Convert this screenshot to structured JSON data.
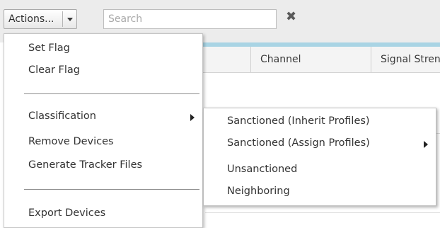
{
  "toolbar": {
    "actions_label": "Actions...",
    "search_placeholder": "Search",
    "clear_glyph": "✖"
  },
  "table": {
    "columns": [
      "Channel",
      "Signal Strength"
    ]
  },
  "actions_menu": {
    "items": [
      {
        "label": "Set Flag"
      },
      {
        "label": "Clear Flag"
      },
      {
        "label": "Classification",
        "has_submenu": true
      },
      {
        "label": "Remove Devices"
      },
      {
        "label": "Generate Tracker Files"
      },
      {
        "label": "Export Devices"
      }
    ]
  },
  "classification_submenu": {
    "items": [
      {
        "label": "Sanctioned (Inherit Profiles)"
      },
      {
        "label": "Sanctioned (Assign Profiles)",
        "has_submenu": true
      },
      {
        "label": "Unsanctioned"
      },
      {
        "label": "Neighboring"
      }
    ]
  },
  "colors": {
    "toolbar_bg": "#ececec",
    "accent_strip": "#a9d4e4",
    "text": "#333333"
  }
}
